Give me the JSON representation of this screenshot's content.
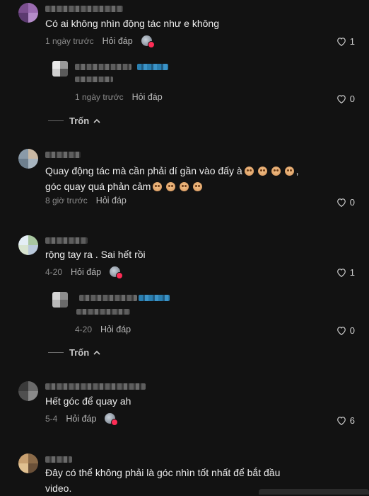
{
  "comments": [
    {
      "text": "Có ai không nhìn động tác như e không",
      "time": "1 ngày trước",
      "reply": "Hỏi đáp",
      "likes": "1",
      "collapse": "Trốn",
      "avatar_colors": [
        "#7b4f8f",
        "#9a6bb0",
        "#5c3a70",
        "#b48cc9"
      ],
      "replies": [
        {
          "text": "",
          "time": "1 ngày trước",
          "reply": "Hỏi đáp",
          "likes": "0",
          "avatar_colors": [
            "#e8e8e8",
            "#9a9a9a",
            "#cfcfcf",
            "#5a5a5a"
          ]
        }
      ]
    },
    {
      "text_line1": "Quay động tác mà cần phải dí gần vào đấy à",
      "text_line1_end": ",",
      "text_line2": "góc quay quá phản cảm",
      "time": "8 giờ trước",
      "reply": "Hỏi đáp",
      "likes": "0",
      "avatar_colors": [
        "#8a9aa8",
        "#c9b8a4",
        "#6e7f8e",
        "#a8b5c0"
      ]
    },
    {
      "text": "rộng tay ra . Sai hết rồi",
      "time": "4-20",
      "reply": "Hỏi đáp",
      "likes": "1",
      "collapse": "Trốn",
      "avatar_colors": [
        "#e4eef5",
        "#a8c6a0",
        "#d8e4d0",
        "#b9c9db"
      ],
      "replies": [
        {
          "text": "",
          "time": "4-20",
          "reply": "Hỏi đáp",
          "likes": "0",
          "avatar_colors": [
            "#d6d6d6",
            "#8d8d8d",
            "#b8b8b8",
            "#6a6a6a"
          ]
        }
      ]
    },
    {
      "text": "Hết góc để quay ah",
      "time": "5-4",
      "reply": "Hỏi đáp",
      "likes": "6",
      "avatar_colors": [
        "#3a3a3a",
        "#6a6a6a",
        "#4f4f4f",
        "#8a8a8a"
      ]
    },
    {
      "text_line1": "Đây có thể không phải là góc nhìn tốt nhất để bắt đầu",
      "text_line2": "video.",
      "avatar_colors": [
        "#c8a070",
        "#8a6a48",
        "#e0c090",
        "#6a5038"
      ]
    }
  ],
  "icons": {
    "heart": "heart-outline-icon",
    "chevron": "chevron-up-icon"
  }
}
